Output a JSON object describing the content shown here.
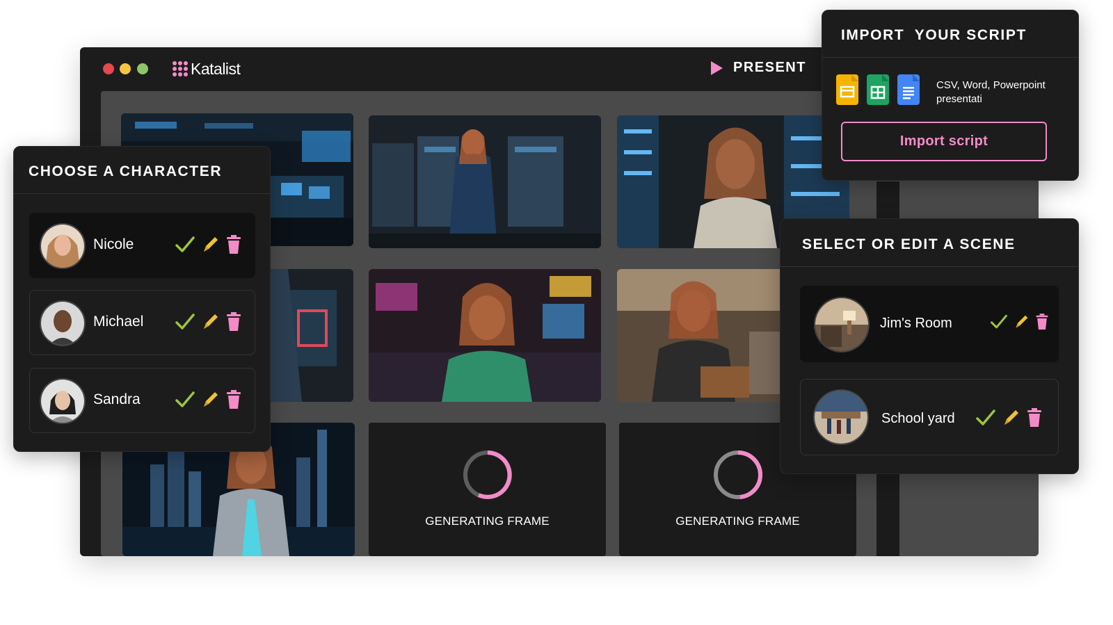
{
  "window": {
    "app_name": "Katalist",
    "present_label": "PRESENT"
  },
  "storyboard": {
    "generating_labels": [
      "GENERATING FRAME",
      "GENERATING FRAME"
    ]
  },
  "character_panel": {
    "title": "CHOOSE A CHARACTER",
    "characters": [
      {
        "name": "Nicole",
        "selected": true
      },
      {
        "name": "Michael",
        "selected": false
      },
      {
        "name": "Sandra",
        "selected": false
      }
    ]
  },
  "import_panel": {
    "title": "IMPORT  YOUR SCRIPT",
    "description": "CSV, Word, Powerpoint presentati",
    "button_label": "Import script",
    "file_icons": [
      "google-slides-icon",
      "google-sheets-icon",
      "google-docs-icon"
    ]
  },
  "scene_panel": {
    "title": "SELECT OR EDIT A SCENE",
    "scenes": [
      {
        "name": "Jim's Room",
        "selected": true
      },
      {
        "name": "School yard",
        "selected": false
      }
    ]
  },
  "colors": {
    "accent_pink": "#f38bc8",
    "check_green": "#9bc53d",
    "edit_yellow": "#f2c230",
    "delete_pink": "#f38bc8",
    "window_bg": "#1c1c1c",
    "canvas_bg": "#4a4a4a"
  }
}
